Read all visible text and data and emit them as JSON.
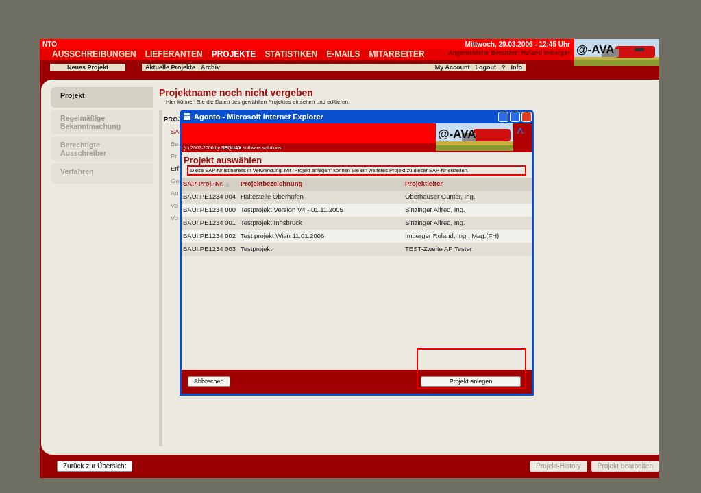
{
  "header": {
    "cut_text": "NTO",
    "date": "Mittwoch, 29.03.2006 - 12:45 Uhr",
    "user": "Angemeldeter Benutzer: Roland Imberger",
    "logo": "@-AVA"
  },
  "nav": [
    {
      "label": "AUSSCHREIBUNGEN",
      "selected": false
    },
    {
      "label": "LIEFERANTEN",
      "selected": false
    },
    {
      "label": "PROJEKTE",
      "selected": true
    },
    {
      "label": "STATISTIKEN",
      "selected": false
    },
    {
      "label": "E-MAILS",
      "selected": false
    },
    {
      "label": "MITARBEITER",
      "selected": false
    }
  ],
  "subnav": {
    "left": [
      "Neues Projekt"
    ],
    "middle": [
      "Aktuelle Projekte",
      "Archiv"
    ],
    "right": [
      "My Account",
      "Logout",
      "?",
      "Info"
    ]
  },
  "sidebar": [
    {
      "label": "Projekt",
      "selected": true,
      "disabled": false
    },
    {
      "label": "Regelmäßige Bekanntmachung",
      "selected": false,
      "disabled": true
    },
    {
      "label": "Berechtigte Ausschreiber",
      "selected": false,
      "disabled": true
    },
    {
      "label": "Verfahren",
      "selected": false,
      "disabled": true
    }
  ],
  "page": {
    "title": "Projektname noch nicht vergeben",
    "subtitle": "Hier können Sie die Daten des gewählten Projektes einsehen und editieren.",
    "fragments": [
      {
        "text": "PROJ",
        "kind": "heading"
      },
      {
        "text": "SA",
        "kind": "accent"
      },
      {
        "text": "Be",
        "kind": "muted"
      },
      {
        "text": "Pr",
        "kind": "muted"
      },
      {
        "text": "Erf",
        "kind": "normal"
      },
      {
        "text": "Ge",
        "kind": "muted"
      },
      {
        "text": "Au",
        "kind": "muted"
      },
      {
        "text": "Vo",
        "kind": "muted"
      },
      {
        "text": "Vo",
        "kind": "muted"
      }
    ]
  },
  "footer": [
    {
      "label": "Zurück zur Übersicht",
      "disabled": false
    },
    {
      "label": "Projekt-History",
      "disabled": true
    },
    {
      "label": "Projekt bearbeiten",
      "disabled": true
    }
  ],
  "dialog": {
    "title": "Agonto - Microsoft Internet Explorer",
    "copyright": "(c) 2002-2006 by **SEQUAX** software solutions",
    "logo": "@-AVA",
    "heading": "Projekt auswählen",
    "notice": "Diese SAP-Nr ist bereits in Verwendung. Mit \"Projekt anlegen\" können Sie ein weiteres Projekt zu dieser SAP-Nr erstellen.",
    "columns": [
      "SAP-Proj.-Nr.",
      "Projektbezeichnung",
      "Projektleiter"
    ],
    "rows": [
      [
        "BAUI.PE1234 004",
        "Haltestelle Oberhofen",
        "Oberhauser Günter, Ing."
      ],
      [
        "BAUI.PE1234 000",
        "Testprojekt Version V4 - 01.11.2005",
        "Sinzinger Alfred, Ing."
      ],
      [
        "BAUI.PE1234 001",
        "Testprojekt Innsbruck",
        "Sinzinger Alfred, Ing."
      ],
      [
        "BAUI.PE1234 002",
        "Test projekt Wien 11.01.2006",
        "Imberger Roland, Ing., Mag.(FH)"
      ],
      [
        "BAUI.PE1234 003",
        "Testprojekt",
        "TEST-Zweite AP Tester"
      ]
    ],
    "buttons": [
      "Abbrechen",
      "Projekt anlegen"
    ]
  }
}
